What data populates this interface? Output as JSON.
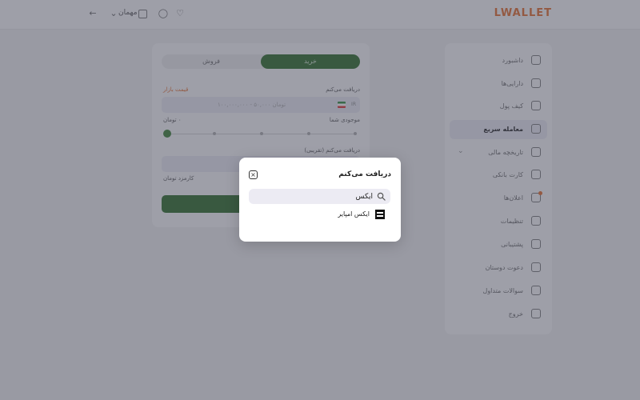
{
  "header": {
    "logo": "LWALLET",
    "username": "مهمان"
  },
  "sidebar": {
    "items": [
      {
        "label": "داشبورد",
        "icon": "dashboard-icon",
        "active": false
      },
      {
        "label": "دارایی‌ها",
        "icon": "wallet-icon",
        "active": false
      },
      {
        "label": "کیف پول",
        "icon": "purse-icon",
        "active": false
      },
      {
        "label": "معامله سریع",
        "icon": "swap-icon",
        "active": true
      },
      {
        "label": "تاریخچه مالی",
        "icon": "history-icon",
        "active": false,
        "expandable": true
      },
      {
        "label": "کارت بانکی",
        "icon": "card-icon",
        "active": false
      },
      {
        "label": "اعلان‌ها",
        "icon": "bell-icon",
        "active": false,
        "badge": true
      },
      {
        "label": "تنظیمات",
        "icon": "settings-icon",
        "active": false
      },
      {
        "label": "پشتیبانی",
        "icon": "support-icon",
        "active": false
      },
      {
        "label": "دعوت دوستان",
        "icon": "gift-icon",
        "active": false
      },
      {
        "label": "سوالات متداول",
        "icon": "help-icon",
        "active": false
      },
      {
        "label": "خروج",
        "icon": "logout-icon",
        "active": false
      }
    ]
  },
  "trade": {
    "tabs": {
      "buy": "خرید",
      "sell": "فروش"
    },
    "receive_label": "دریافت می‌کنم",
    "market_price": "قیمت بازار",
    "amount_placeholder": "۱۰۰,۰۰۰,۰۰۰ - ۵۰,۰۰۰ تومان",
    "currency_code": "IR",
    "inventory_label": "موجودی شما",
    "inventory_value": "۰ تومان",
    "receive_amount_label": "دریافت می‌کنم (تقریبی)",
    "fee_label": "کارمزد تومان"
  },
  "modal": {
    "title": "دریافت می‌کنم",
    "search_value": "ایکس",
    "results": [
      {
        "name": "ایکس امپایر",
        "icon": "x-empire-logo-icon"
      }
    ]
  }
}
